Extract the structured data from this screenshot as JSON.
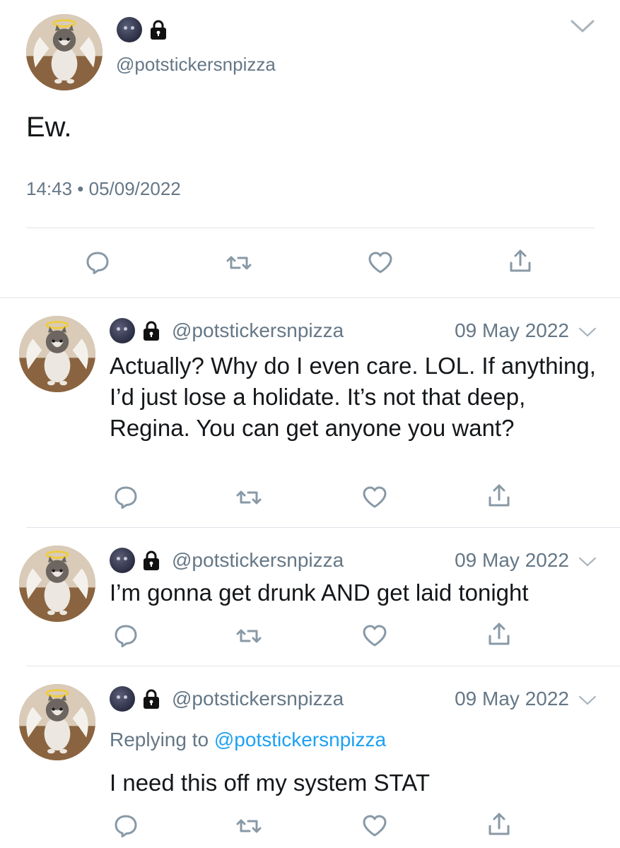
{
  "main_tweet": {
    "handle": "@potstickersnpizza",
    "text": "Ew.",
    "timestamp": "14:43 • 05/09/2022"
  },
  "replies": [
    {
      "handle": "@potstickersnpizza",
      "date": "09 May 2022",
      "text": "Actually? Why do I even care. LOL. If anything, I’d just lose a holidate. It’s not that deep, Regina. You can get anyone you want?"
    },
    {
      "handle": "@potstickersnpizza",
      "date": "09 May 2022",
      "text": "I’m gonna get drunk AND get laid tonight"
    },
    {
      "handle": "@potstickersnpizza",
      "date": "09 May 2022",
      "replying_prefix": "Replying to",
      "replying_handle": "@potstickersnpizza",
      "text": "I need this off my system STAT"
    }
  ],
  "icons": {
    "emoji": "new-moon-face-icon",
    "lock": "lock-icon",
    "menu": "chevron-down-icon",
    "actions": [
      "reply-icon",
      "retweet-icon",
      "like-icon",
      "share-icon"
    ]
  },
  "colors": {
    "text": "#14171a",
    "secondary": "#657786",
    "link": "#1da1f2",
    "icon": "#8899a6",
    "divider": "#dfe3e8"
  }
}
